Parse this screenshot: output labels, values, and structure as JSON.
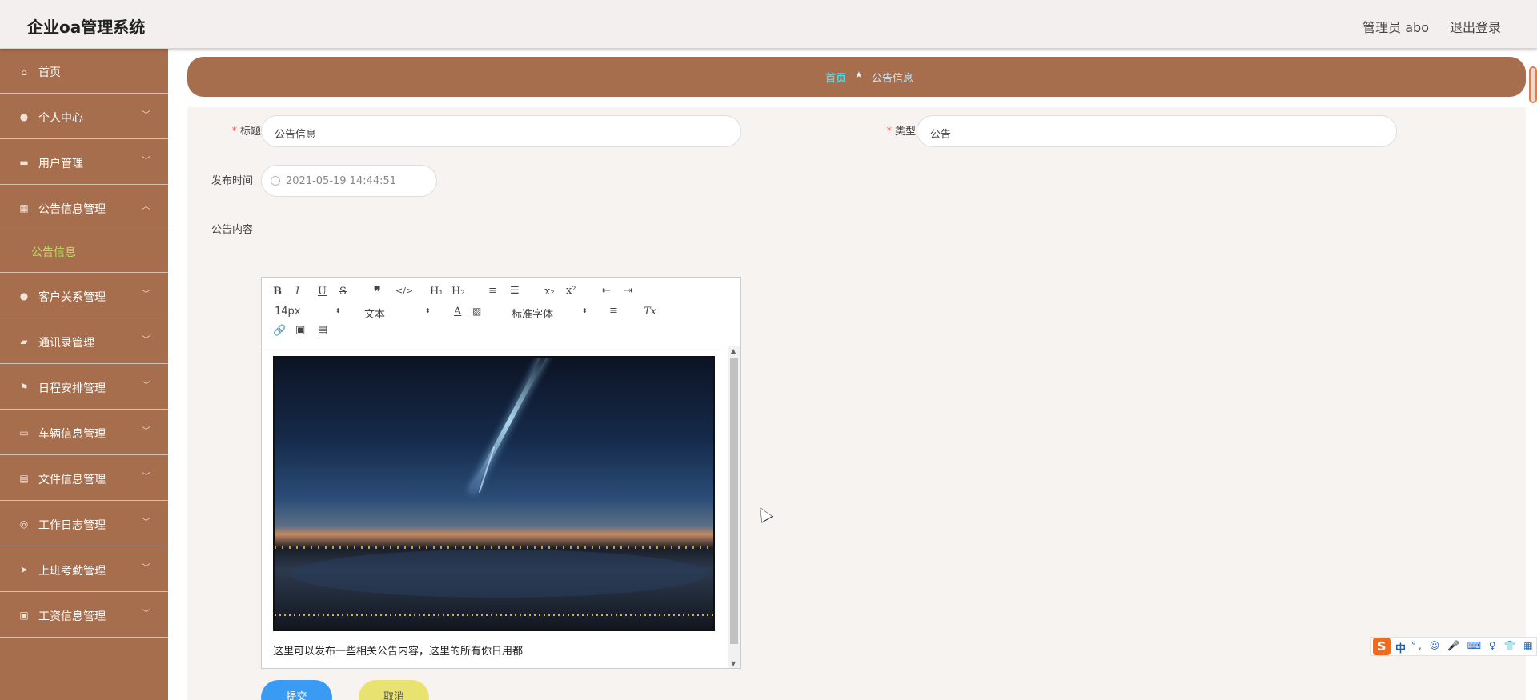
{
  "header": {
    "app_title": "企业oa管理系统",
    "admin_label": "管理员 abo",
    "logout_label": "退出登录"
  },
  "sidebar": {
    "items": [
      {
        "label": "首页",
        "icon": "home-icon"
      },
      {
        "label": "个人中心",
        "icon": "user-icon"
      },
      {
        "label": "用户管理",
        "icon": "users-icon"
      },
      {
        "label": "公告信息管理",
        "icon": "grid-icon",
        "expanded": true
      },
      {
        "label": "客户关系管理",
        "icon": "contact-icon"
      },
      {
        "label": "通讯录管理",
        "icon": "briefcase-icon"
      },
      {
        "label": "日程安排管理",
        "icon": "flag-icon"
      },
      {
        "label": "车辆信息管理",
        "icon": "chat-icon"
      },
      {
        "label": "文件信息管理",
        "icon": "clipboard-icon"
      },
      {
        "label": "工作日志管理",
        "icon": "compass-icon"
      },
      {
        "label": "上班考勤管理",
        "icon": "send-icon"
      },
      {
        "label": "工资信息管理",
        "icon": "id-card-icon"
      }
    ],
    "submenu": {
      "label": "公告信息",
      "active_color": "#b6e05c"
    }
  },
  "breadcrumb": {
    "home": "首页",
    "separator": "★",
    "current": "公告信息"
  },
  "form": {
    "title_label": "标题",
    "title_value": "公告信息",
    "type_label": "类型",
    "type_value": "公告",
    "time_label": "发布时间",
    "time_value": "2021-05-19 14:44:51",
    "content_label": "公告内容",
    "required_mark": "*"
  },
  "editor": {
    "font_size": "14px",
    "text_style": "文本",
    "font_family": "标准字体",
    "content_text": "这里可以发布一些相关公告内容，这里的所有你日用都"
  },
  "buttons": {
    "submit": "提交",
    "cancel": "取消"
  },
  "ime": {
    "logo": "S",
    "mode": "中",
    "extras": "°, ☺ 🎤 ⌨ ♀ 👕 ▦"
  },
  "colors": {
    "sidebar_bg": "#a66e4c",
    "breadcrumb_bg": "#a66e4c",
    "submit_bg": "#3a9bf5",
    "cancel_bg": "#e8e370",
    "crumb_home": "#52d8e8"
  }
}
